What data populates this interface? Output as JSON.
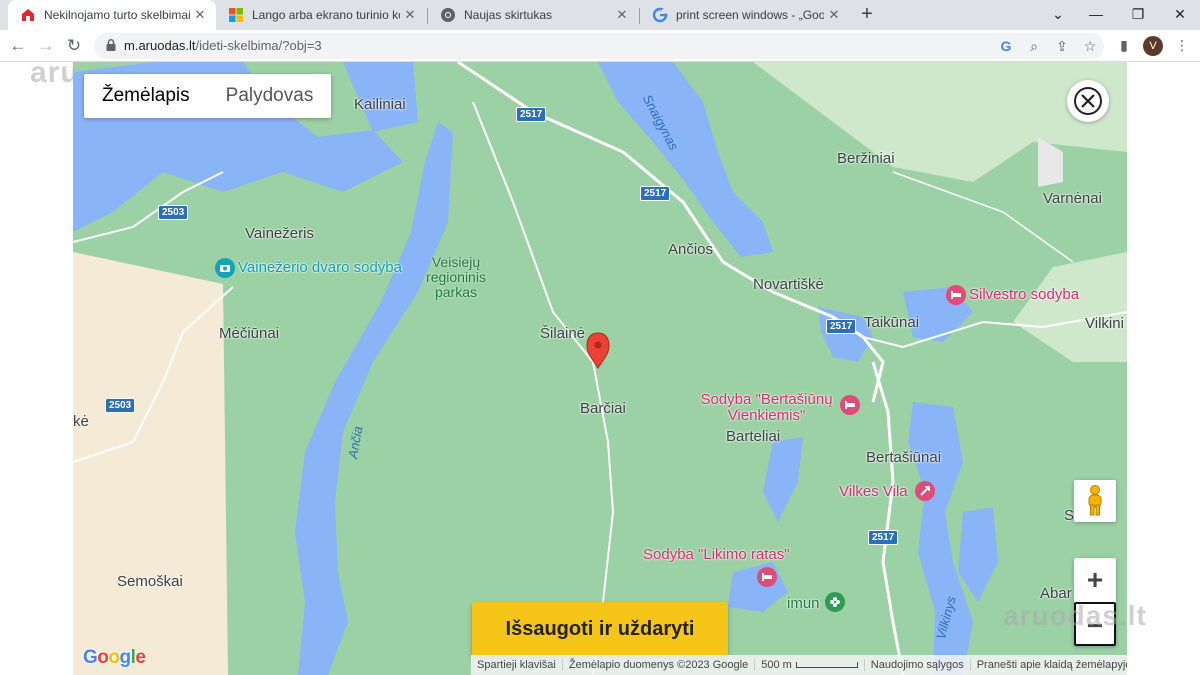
{
  "browser": {
    "tabs": [
      {
        "title": "Nekilnojamo turto skelbimai - Ar",
        "icon": "aruodas-favicon",
        "active": true
      },
      {
        "title": "Lango arba ekrano turinio kopija",
        "icon": "microsoft-favicon",
        "active": false
      },
      {
        "title": "Naujas skirtukas",
        "icon": "chrome-favicon",
        "active": false
      },
      {
        "title": "print screen windows - „Google“",
        "icon": "google-favicon",
        "active": false
      }
    ],
    "new_tab": "+",
    "url_host": "m.aruodas.lt",
    "url_path": "/ideti-skelbima/?obj=3",
    "profile_initial": "V"
  },
  "map": {
    "type_tabs": {
      "map": "Žemėlapis",
      "satellite": "Palydovas"
    },
    "places": {
      "kailiniai": "Kailiniai",
      "berziniai": "Beržiniai",
      "varnenai": "Varnėnai",
      "vainezeris": "Vainežeris",
      "ancios": "Ančios",
      "novartiske": "Novartiškė",
      "taikunai": "Taikūnai",
      "vilkiniai": "Vilkini",
      "meciunai": "Mėčiūnai",
      "silaine": "Šilainė",
      "barciai": "Barčiai",
      "barteliai": "Barteliai",
      "bertasiunai": "Bertašiūnai",
      "senko": "Senko",
      "semoskai": "Semoškai",
      "abar": "Abar",
      "ke": "kė"
    },
    "pois": {
      "vainezerio": "Vainežerio dvaro sodyba",
      "silvestro": "Silvestro sodyba",
      "bertasiunu": "Sodyba \"Bertašiūnų Vienkiemis\"",
      "vilkes": "Vilkes Vila",
      "likimo": "Sodyba \"Likimo ratas\"",
      "imun": "imun"
    },
    "park": "Veisiejų regioninis parkas",
    "water": {
      "snaigynas": "Snaigynas",
      "ancia": "Ančia",
      "vilkinys": "Vilkinys"
    },
    "roads": {
      "r2503": "2503",
      "r2517": "2517"
    },
    "save_button": "Išsaugoti ir uždaryti",
    "zoom_in": "+",
    "zoom_out": "−",
    "google_logo": "Google",
    "attribution": {
      "shortcuts": "Spartieji klavišai",
      "data": "Žemėlapio duomenys ©2023 Google",
      "scale": "500 m",
      "terms": "Naudojimo sąlygos",
      "report": "Pranešti apie klaidą žemėlapyje"
    },
    "colors": {
      "land": "#9bd1a5",
      "water": "#8ab4f8",
      "farmland": "#f5ead6",
      "marker": "#ea4335",
      "save_button": "#f5c518"
    }
  },
  "watermark": "aruodas.lt"
}
